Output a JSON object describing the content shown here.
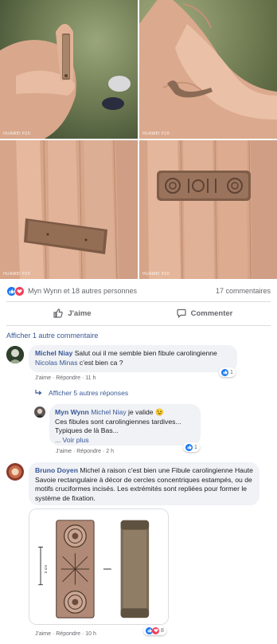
{
  "photos": {
    "camera_label": "HUAWEI P20",
    "images": [
      "hand-photo-top-left",
      "hand-photo-top-right",
      "hand-photo-bottom-left",
      "hand-photo-bottom-right"
    ]
  },
  "reactions": {
    "icons": [
      "like-icon",
      "love-icon"
    ],
    "text": "Myn Wynn et 18 autres personnes",
    "comments": "17 commentaires"
  },
  "actions": {
    "like_label": "J'aime",
    "comment_label": "Commenter"
  },
  "show_more": "Afficher 1 autre commentaire",
  "comments": [
    {
      "author": "Michel Niay",
      "text_1": "Salut oui il me semble bien fibule carolingienne",
      "mention": "Nicolas Minas",
      "text_2": "c'est bien ca ?",
      "like": "J'aime",
      "reply": "Répondre",
      "time": "11 h",
      "reaction_count": "1"
    },
    {
      "author": "Bruno Doyen",
      "text": "Michel à raison c'est bien une Fibule carolingienne Haute Savoie rectangulaire à décor de cercles concentriques estampés, ou de motifs cruciformes incisés. Les extrémités sont repliées pour former le système de fixation.",
      "image": "fibule-drawing-and-photo",
      "scale_label": "2 cm",
      "like": "J'aime",
      "reply": "Répondre",
      "time": "10 h",
      "reaction_count": "8"
    }
  ],
  "replies": {
    "link": "Afficher 5 autres réponses",
    "reply": {
      "author": "Myn Wynn",
      "mention": "Michel Niay",
      "text_1": "je valide",
      "emoji": "😉",
      "line_2": "Ces fibules sont carolingiennes tardives...",
      "line_3": "Typiques de là Bas...",
      "see_more": "... Voir plus",
      "like": "J'aime",
      "reply": "Répondre",
      "time": "2 h",
      "reaction_count": "1"
    }
  },
  "colors": {
    "link": "#385898",
    "like_blue": "#1877f2",
    "love_red": "#f33e58",
    "bubble": "#f0f2f5"
  }
}
